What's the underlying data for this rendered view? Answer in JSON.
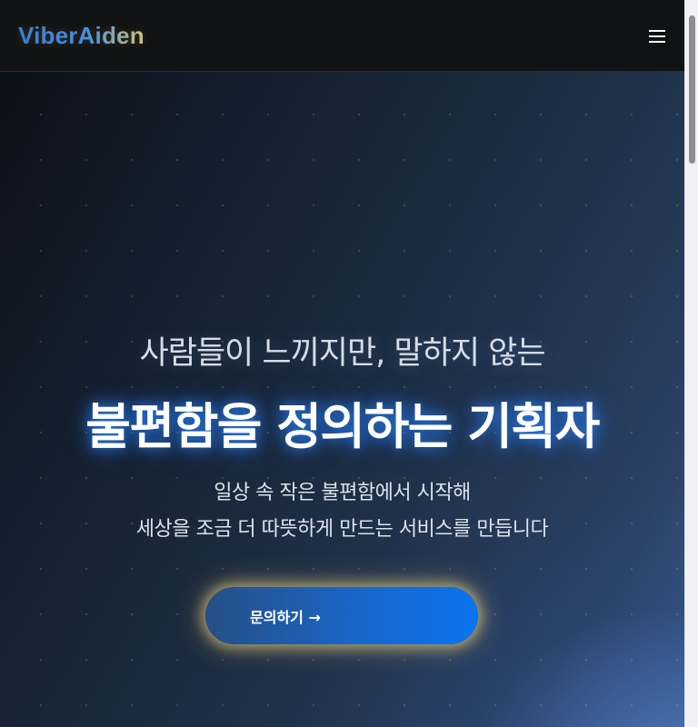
{
  "brand": {
    "logo_text": "ViberAiden"
  },
  "nav": {
    "menu_icon": "hamburger-menu-icon"
  },
  "hero": {
    "eyebrow": "사람들이 느끼지만, 말하지 않는",
    "headline": "불편함을 정의하는 기획자",
    "description_line1": "일상 속 작은 불편함에서 시작해",
    "description_line2": "세상을 조금 더 따뜻하게 만드는 서비스를 만듭니다",
    "cta_label": "문의하기 →"
  },
  "colors": {
    "accent_blue": "#0a74ef",
    "glow_gold": "#ffe482",
    "navbar_bg": "#111213"
  }
}
